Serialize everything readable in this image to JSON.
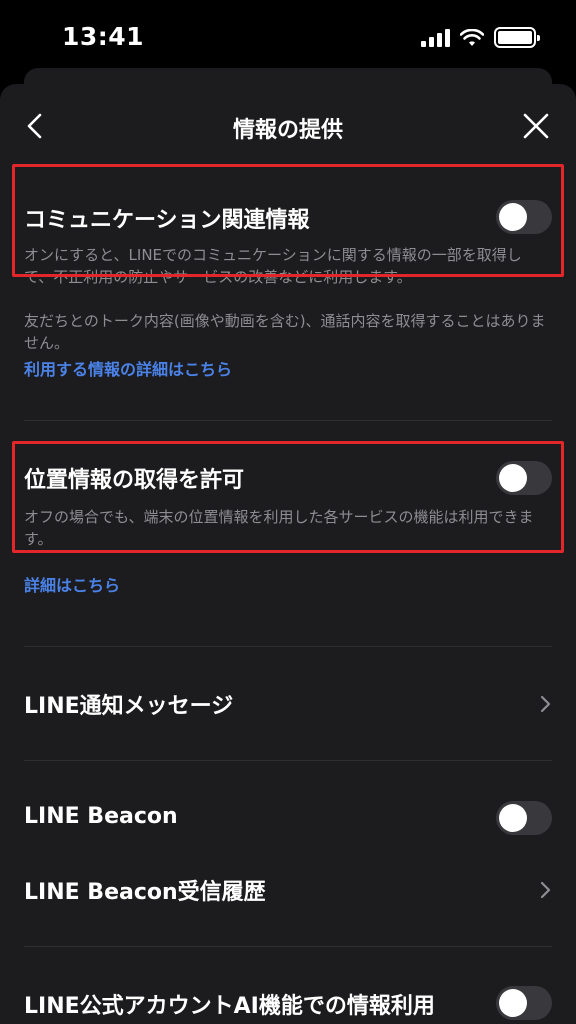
{
  "status_bar": {
    "time": "13:41"
  },
  "nav": {
    "title": "情報の提供"
  },
  "communication": {
    "title": "コミュニケーション関連情報",
    "desc_1": "オンにすると、LINEでのコミュニケーションに関する情報の一部を取得して、不正利用の防止やサービスの改善などに利用します。",
    "desc_2": "友だちとのトーク内容(画像や動画を含む)、通話内容を取得することはありません。",
    "link": "利用する情報の詳細はこちら",
    "toggle_on": false
  },
  "location": {
    "title": "位置情報の取得を許可",
    "desc": "オフの場合でも、端末の位置情報を利用した各サービスの機能は利用できます。",
    "link": "詳細はこちら",
    "toggle_on": false
  },
  "notification": {
    "title": "LINE通知メッセージ"
  },
  "beacon": {
    "title": "LINE Beacon",
    "toggle_on": false
  },
  "beacon_history": {
    "title": "LINE Beacon受信履歴"
  },
  "official_ai": {
    "title": "LINE公式アカウントAI機能での情報利用",
    "toggle_on": false
  },
  "colors": {
    "background": "#1c1c1e",
    "link": "#4a82e8",
    "highlight": "#e3262a",
    "toggle_off": "#39393d"
  }
}
